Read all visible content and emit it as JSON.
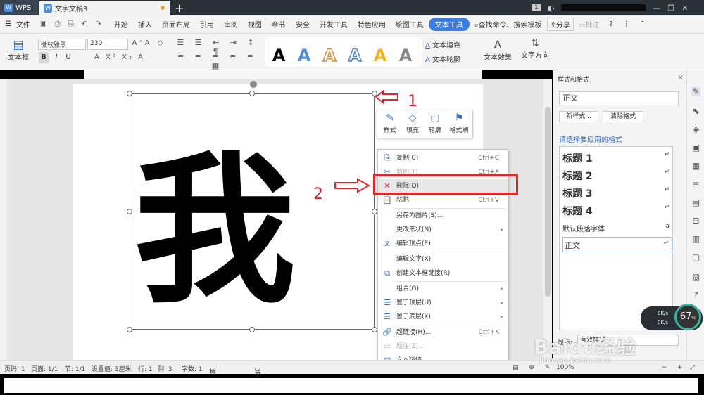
{
  "titlebar": {
    "app_name": "WPS",
    "doc_tab": "文字文稿3",
    "new_tab_symbol": "+",
    "badge": "1"
  },
  "menubar": {
    "file_label": "文件",
    "items": [
      "开始",
      "插入",
      "页面布局",
      "引用",
      "审阅",
      "视图",
      "章节",
      "安全",
      "开发工具",
      "特色应用",
      "绘图工具",
      "文本工具"
    ],
    "active": "文本工具",
    "search_label": "查找命令、搜索模板",
    "share_label": "分享",
    "annot_label": "批注",
    "help": "?"
  },
  "ribbon": {
    "textbox_label": "文本框",
    "font_name": "微软雅黑",
    "font_size": "230",
    "bold": "B",
    "italic": "I",
    "underline": "U",
    "text_fill": "文本填充",
    "text_outline": "文本轮廓",
    "text_effect": "文本效果",
    "text_direction": "文字方向",
    "sample_letter": "A"
  },
  "canvas": {
    "big_char": "我"
  },
  "float_toolbar": {
    "items": [
      "样式",
      "填充",
      "轮廓",
      "格式刷"
    ]
  },
  "context_menu": {
    "items": [
      {
        "label": "复制(C)",
        "shortcut": "Ctrl+C"
      },
      {
        "label": "剪切(T)",
        "shortcut": "Ctrl+X"
      },
      {
        "label": "删除(D)",
        "shortcut": ""
      },
      {
        "label": "粘贴",
        "shortcut": "Ctrl+V"
      },
      {
        "label": "另存为图片(S)...",
        "shortcut": ""
      },
      {
        "label": "更改形状(N)",
        "shortcut": ""
      },
      {
        "label": "编辑顶点(E)",
        "shortcut": ""
      },
      {
        "label": "编辑文字(X)",
        "shortcut": ""
      },
      {
        "label": "创建文本框链接(R)",
        "shortcut": ""
      },
      {
        "label": "组合(G)",
        "shortcut": ""
      },
      {
        "label": "置于顶层(U)",
        "shortcut": ""
      },
      {
        "label": "置于底层(K)",
        "shortcut": ""
      },
      {
        "label": "超链接(H)...",
        "shortcut": "Ctrl+K"
      },
      {
        "label": "题注(Z)...",
        "shortcut": ""
      },
      {
        "label": "文本环绕",
        "shortcut": ""
      }
    ]
  },
  "annotations": {
    "num1": "1",
    "num2": "2"
  },
  "style_pane": {
    "title": "样式和格式",
    "current_style": "正文",
    "new_style_btn": "新样式...",
    "clear_format_btn": "清除格式",
    "prompt": "请选择要应用的格式",
    "styles": [
      "标题 1",
      "标题 2",
      "标题 3",
      "标题 4",
      "默认段落字体",
      "正文"
    ],
    "show_label": "显示:",
    "show_value": "有效样式"
  },
  "statusbar": {
    "page_num": "页码: 1",
    "pages": "页面: 1/1",
    "section": "节: 1/1",
    "setting": "设置值: 3厘米",
    "row": "行: 1",
    "col": "列: 3",
    "words": "字数: 1",
    "spell": "拼写检查",
    "cert": "未认证",
    "zoom": "100%"
  },
  "net": {
    "up": "0K/s",
    "down": "0K/s",
    "gauge": "67"
  },
  "watermark": {
    "main": "Baidu经验",
    "sub": "jingyan.baidu.com"
  }
}
